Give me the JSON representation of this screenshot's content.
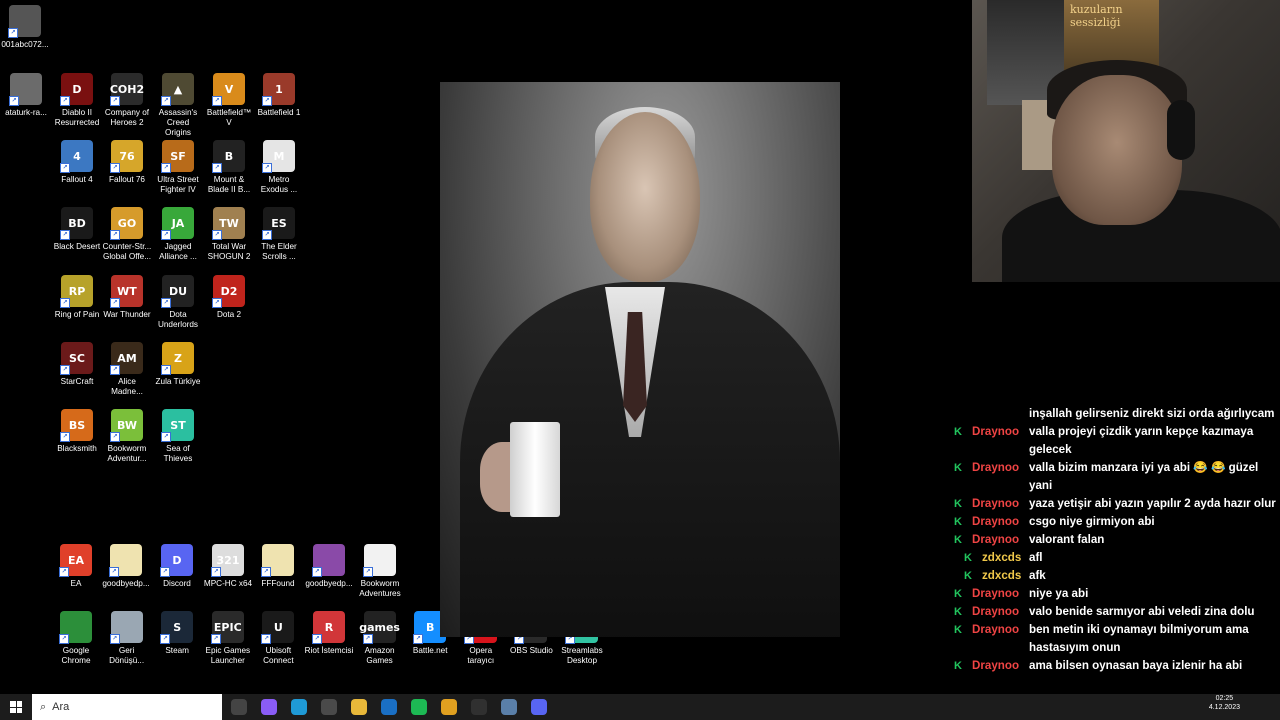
{
  "desktop": {
    "top_file": {
      "label": "001abc072...",
      "color": "#555555"
    },
    "icons": [
      {
        "label": "ataturk-ra...",
        "glyph": "",
        "color": "#6b6b6b"
      },
      {
        "label": "Diablo II Resurrected",
        "glyph": "D",
        "color": "#7a1010"
      },
      {
        "label": "Company of Heroes 2",
        "glyph": "COH2",
        "color": "#2b2b2b"
      },
      {
        "label": "Assassin's Creed Origins",
        "glyph": "▲",
        "color": "#4f4a33"
      },
      {
        "label": "Battlefield™ V",
        "glyph": "V",
        "color": "#d98b1b"
      },
      {
        "label": "Battlefield 1",
        "glyph": "1",
        "color": "#9a3a2a"
      },
      {
        "label": "Fallout 4",
        "glyph": "4",
        "color": "#3c78c2"
      },
      {
        "label": "Fallout 76",
        "glyph": "76",
        "color": "#d6a62a"
      },
      {
        "label": "Ultra Street Fighter IV",
        "glyph": "SF",
        "color": "#b86b1a"
      },
      {
        "label": "Mount & Blade II B...",
        "glyph": "B",
        "color": "#222222"
      },
      {
        "label": "Metro Exodus ...",
        "glyph": "M",
        "color": "#e5e5e5"
      },
      {
        "label": "Black Desert",
        "glyph": "BD",
        "color": "#1a1a1a"
      },
      {
        "label": "Counter-Str... Global Offe...",
        "glyph": "GO",
        "color": "#d69b2b"
      },
      {
        "label": "Jagged Alliance ...",
        "glyph": "JA",
        "color": "#38a83a"
      },
      {
        "label": "Total War SHOGUN 2",
        "glyph": "TW",
        "color": "#a08050"
      },
      {
        "label": "The Elder Scrolls ...",
        "glyph": "ES",
        "color": "#1a1a1a"
      },
      {
        "label": "Ring of Pain",
        "glyph": "RP",
        "color": "#b7a22a"
      },
      {
        "label": "War Thunder",
        "glyph": "WT",
        "color": "#b8332a"
      },
      {
        "label": "Dota Underlords",
        "glyph": "DU",
        "color": "#222222"
      },
      {
        "label": "Dota 2",
        "glyph": "D2",
        "color": "#c0241c"
      },
      {
        "label": "StarCraft",
        "glyph": "SC",
        "color": "#6b1a1a"
      },
      {
        "label": "Alice Madne...",
        "glyph": "AM",
        "color": "#3a2a1a"
      },
      {
        "label": "Zula Türkiye",
        "glyph": "Z",
        "color": "#d8a318"
      },
      {
        "label": "Blacksmith",
        "glyph": "BS",
        "color": "#d66a1a"
      },
      {
        "label": "Bookworm Adventur...",
        "glyph": "BW",
        "color": "#7bbf3a"
      },
      {
        "label": "Sea of Thieves",
        "glyph": "ST",
        "color": "#2bbfa0"
      }
    ],
    "row_icons": [
      {
        "label": "EA",
        "glyph": "EA",
        "color": "#e0402a"
      },
      {
        "label": "goodbyedp...",
        "glyph": "",
        "color": "#efe3b0"
      },
      {
        "label": "Discord",
        "glyph": "D",
        "color": "#5865f2"
      },
      {
        "label": "MPC-HC x64",
        "glyph": "321",
        "color": "#dddddd"
      },
      {
        "label": "FFFound",
        "glyph": "",
        "color": "#efe3b0"
      },
      {
        "label": "goodbyedp...",
        "glyph": "",
        "color": "#8a4aa8"
      },
      {
        "label": "Bookworm Adventures",
        "glyph": "",
        "color": "#f2f2f2"
      },
      {
        "label": "Google Chrome",
        "glyph": "",
        "color": "#2c8f3a"
      },
      {
        "label": "Geri Dönüşü...",
        "glyph": "",
        "color": "#9aa7b3"
      },
      {
        "label": "Steam",
        "glyph": "S",
        "color": "#1b2838"
      },
      {
        "label": "Epic Games Launcher",
        "glyph": "EPIC",
        "color": "#2a2a2a"
      },
      {
        "label": "Ubisoft Connect",
        "glyph": "U",
        "color": "#1a1a1a"
      },
      {
        "label": "Riot İstemcisi",
        "glyph": "R",
        "color": "#d13639"
      },
      {
        "label": "Amazon Games",
        "glyph": "games",
        "color": "#222222"
      },
      {
        "label": "Battle.net",
        "glyph": "B",
        "color": "#148eff"
      },
      {
        "label": "Opera tarayıcı",
        "glyph": "O",
        "color": "#d8141c"
      },
      {
        "label": "OBS Studio",
        "glyph": "OBS",
        "color": "#2a2a2a"
      },
      {
        "label": "Streamlabs Desktop",
        "glyph": "SL",
        "color": "#31c3a2"
      }
    ]
  },
  "chat": {
    "messages": [
      {
        "user": "",
        "badge": "",
        "text": "inşallah gelirseniz direkt sizi orda ağırlıycam",
        "alt": false
      },
      {
        "user": "Draynoo",
        "badge": "K",
        "text": "valla projeyi çizdik yarın kepçe kazımaya gelecek",
        "alt": false
      },
      {
        "user": "Draynoo",
        "badge": "K",
        "text": "valla bizim manzara iyi ya abi 😂 😂 güzel yani",
        "alt": false
      },
      {
        "user": "Draynoo",
        "badge": "K",
        "text": "yaza yetişir abi yazın yapılır 2 ayda hazır olur",
        "alt": false
      },
      {
        "user": "Draynoo",
        "badge": "K",
        "text": "csgo niye girmiyon abi",
        "alt": false
      },
      {
        "user": "Draynoo",
        "badge": "K",
        "text": "valorant falan",
        "alt": false
      },
      {
        "user": "zdxcds",
        "badge": "K",
        "text": "afl",
        "alt": true
      },
      {
        "user": "zdxcds",
        "badge": "K",
        "text": "afk",
        "alt": true
      },
      {
        "user": "Draynoo",
        "badge": "K",
        "text": "niye ya abi",
        "alt": false
      },
      {
        "user": "Draynoo",
        "badge": "K",
        "text": "valo benide sarmıyor abi veledi zina dolu",
        "alt": false
      },
      {
        "user": "Draynoo",
        "badge": "K",
        "text": "ben metin iki oynamayı bilmiyorum ama hastasıyım onun",
        "alt": false
      },
      {
        "user": "Draynoo",
        "badge": "K",
        "text": "ama bilsen oynasan baya izlenir ha abi",
        "alt": false
      }
    ]
  },
  "webcam": {
    "poster_text": "kuzuların sessizliği"
  },
  "taskbar": {
    "search_placeholder": "Ara",
    "apps": [
      {
        "name": "task-view",
        "color": "#444444"
      },
      {
        "name": "copilot",
        "color": "#8a5cf6"
      },
      {
        "name": "edge",
        "color": "#1f9ad6"
      },
      {
        "name": "store",
        "color": "#4a4a4a"
      },
      {
        "name": "explorer",
        "color": "#e8b83a"
      },
      {
        "name": "outlook",
        "color": "#1a6fc4"
      },
      {
        "name": "spotify",
        "color": "#1db954"
      },
      {
        "name": "chrome",
        "color": "#e0a020"
      },
      {
        "name": "obs",
        "color": "#303030"
      },
      {
        "name": "settings",
        "color": "#5a7fa8"
      },
      {
        "name": "discord",
        "color": "#5865f2"
      }
    ],
    "time": "02:25",
    "date": "4.12.2023"
  }
}
